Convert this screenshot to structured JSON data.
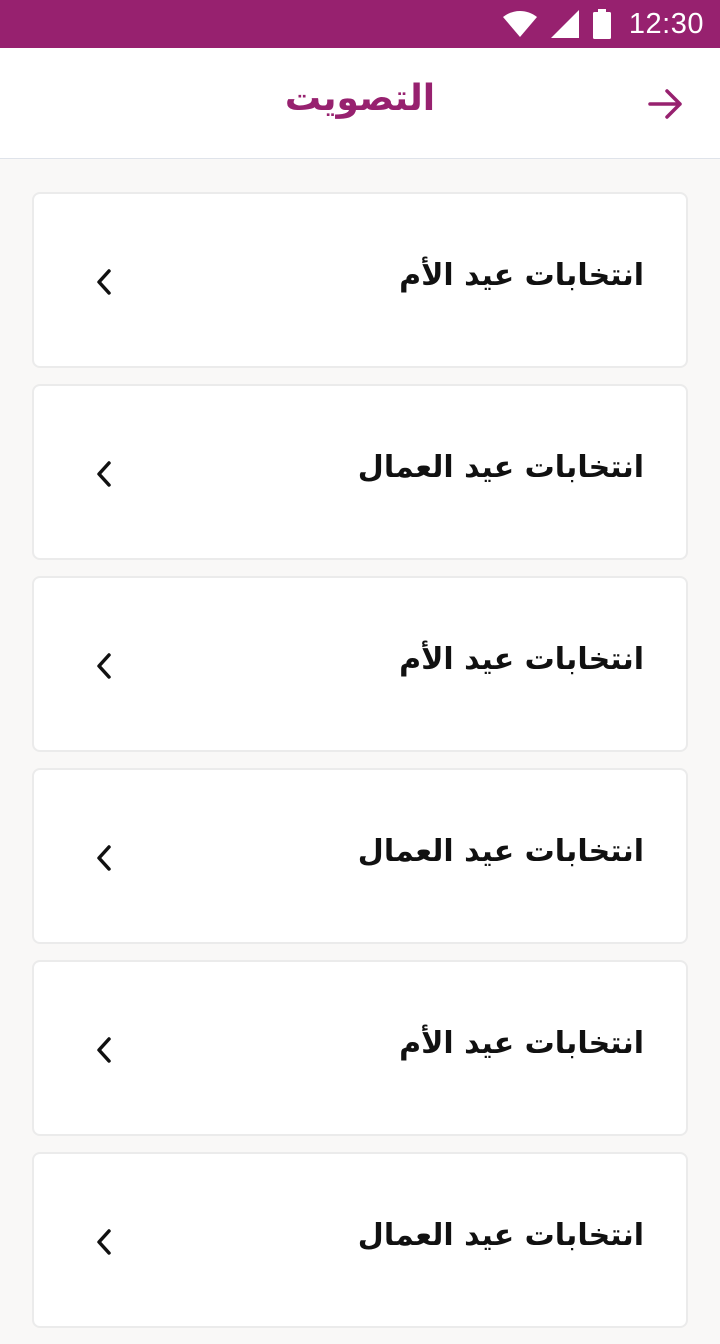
{
  "status_bar": {
    "time": "12:30",
    "icons": [
      "wifi-icon",
      "signal-icon",
      "battery-icon"
    ],
    "color": "#97216f"
  },
  "header": {
    "title": "التصويت",
    "back_icon": "arrow-right-icon",
    "accent_color": "#97216f"
  },
  "list": {
    "items": [
      {
        "label": "انتخابات عيد الأم"
      },
      {
        "label": "انتخابات عيد العمال"
      },
      {
        "label": "انتخابات عيد الأم"
      },
      {
        "label": "انتخابات عيد العمال"
      },
      {
        "label": "انتخابات عيد الأم"
      },
      {
        "label": "انتخابات عيد العمال"
      }
    ],
    "chevron_icon": "chevron-left-icon"
  }
}
